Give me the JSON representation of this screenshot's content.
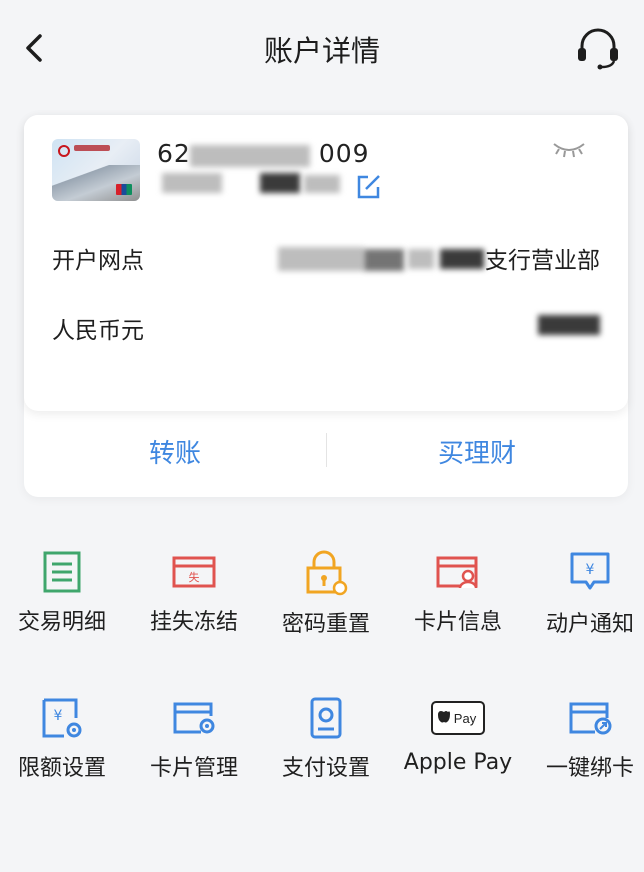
{
  "header": {
    "title": "账户详情"
  },
  "account": {
    "card_number_start": "62",
    "card_number_end": "009",
    "branch_label": "开户网点",
    "branch_value_visible": "支行营业部",
    "currency_label": "人民币元"
  },
  "actions": {
    "transfer": "转账",
    "buy_wealth": "买理财"
  },
  "menu": {
    "row1": [
      {
        "label": "交易明细",
        "icon": "ledger-icon",
        "color": "#3fa66c"
      },
      {
        "label": "挂失冻结",
        "icon": "report-loss-icon",
        "color": "#e0534f"
      },
      {
        "label": "密码重置",
        "icon": "lock-reset-icon",
        "color": "#f1a522"
      },
      {
        "label": "卡片信息",
        "icon": "card-info-icon",
        "color": "#e0534f"
      },
      {
        "label": "动户通知",
        "icon": "notification-icon",
        "color": "#3f87e0"
      }
    ],
    "row2": [
      {
        "label": "限额设置",
        "icon": "limit-settings-icon",
        "color": "#3f87e0"
      },
      {
        "label": "卡片管理",
        "icon": "card-manage-icon",
        "color": "#3f87e0"
      },
      {
        "label": "支付设置",
        "icon": "payment-settings-icon",
        "color": "#3f87e0"
      },
      {
        "label": "Apple Pay",
        "icon": "apple-pay-icon",
        "color": "#222222"
      },
      {
        "label": "一键绑卡",
        "icon": "bind-card-icon",
        "color": "#3f87e0"
      }
    ]
  }
}
